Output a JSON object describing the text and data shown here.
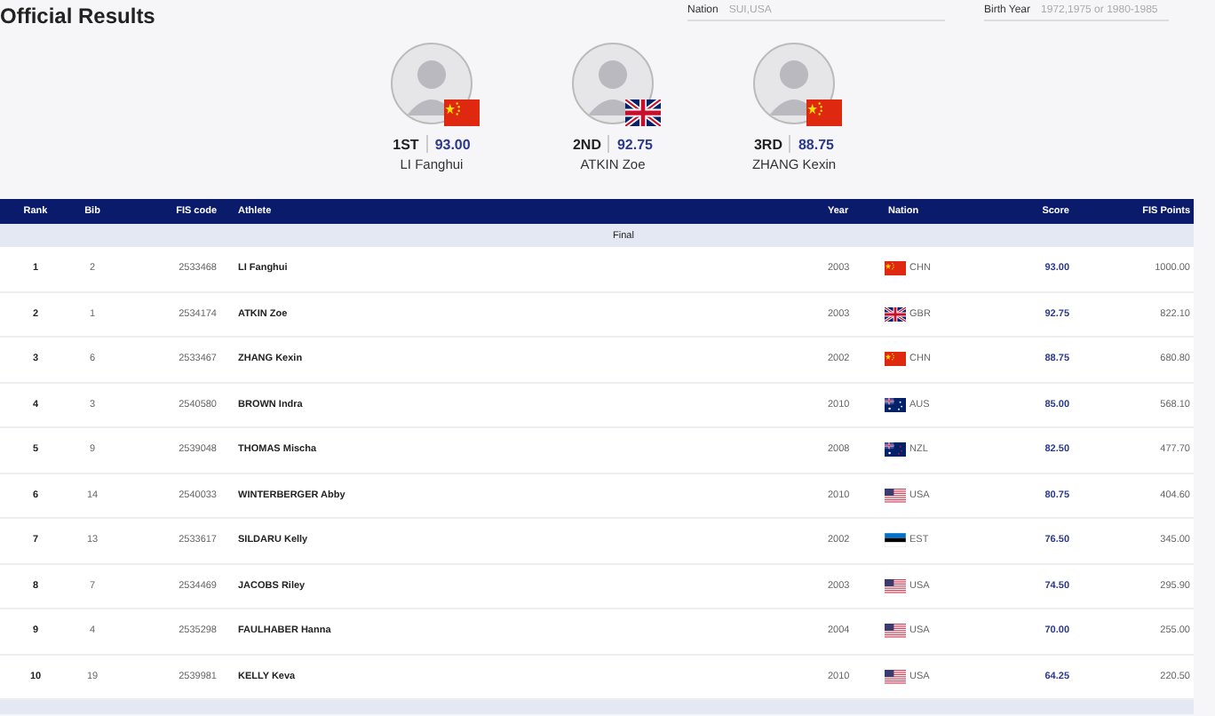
{
  "title": "Official Results",
  "filters": [
    {
      "label": "Nation",
      "placeholder": "SUI,USA"
    },
    {
      "label": "Birth Year",
      "placeholder": "1972,1975 or 1980-1985"
    }
  ],
  "podium": [
    {
      "place": "1ST",
      "score": "93.00",
      "name": "LI Fanghui",
      "kind": "china"
    },
    {
      "place": "2ND",
      "score": "92.75",
      "name": "ATKIN Zoe",
      "kind": "uk"
    },
    {
      "place": "3RD",
      "score": "88.75",
      "name": "ZHANG Kexin",
      "kind": "china"
    }
  ],
  "table": {
    "columns": [
      "Rank",
      "Bib",
      "FIS code",
      "Athlete",
      "Year",
      "Nation",
      "Score",
      "FIS Points"
    ],
    "section": "Final",
    "rows": [
      {
        "rank": "1",
        "bib": "2",
        "fis_code": "2533468",
        "athlete": "LI Fanghui",
        "year": "2003",
        "kind": "china",
        "nation": "CHN",
        "score": "93.00",
        "fis_points": "1000.00"
      },
      {
        "rank": "2",
        "bib": "1",
        "fis_code": "2534174",
        "athlete": "ATKIN Zoe",
        "year": "2003",
        "kind": "uk",
        "nation": "GBR",
        "score": "92.75",
        "fis_points": "822.10"
      },
      {
        "rank": "3",
        "bib": "6",
        "fis_code": "2533467",
        "athlete": "ZHANG Kexin",
        "year": "2002",
        "kind": "china",
        "nation": "CHN",
        "score": "88.75",
        "fis_points": "680.80"
      },
      {
        "rank": "4",
        "bib": "3",
        "fis_code": "2540580",
        "athlete": "BROWN Indra",
        "year": "2010",
        "kind": "australia",
        "nation": "AUS",
        "score": "85.00",
        "fis_points": "568.10"
      },
      {
        "rank": "5",
        "bib": "9",
        "fis_code": "2539048",
        "athlete": "THOMAS Mischa",
        "year": "2008",
        "kind": "newzealand",
        "nation": "NZL",
        "score": "82.50",
        "fis_points": "477.70"
      },
      {
        "rank": "6",
        "bib": "14",
        "fis_code": "2540033",
        "athlete": "WINTERBERGER Abby",
        "year": "2010",
        "kind": "usa",
        "nation": "USA",
        "score": "80.75",
        "fis_points": "404.60"
      },
      {
        "rank": "7",
        "bib": "13",
        "fis_code": "2533617",
        "athlete": "SILDARU Kelly",
        "year": "2002",
        "kind": "estonia",
        "nation": "EST",
        "score": "76.50",
        "fis_points": "345.00"
      },
      {
        "rank": "8",
        "bib": "7",
        "fis_code": "2534469",
        "athlete": "JACOBS Riley",
        "year": "2003",
        "kind": "usa",
        "nation": "USA",
        "score": "74.50",
        "fis_points": "295.90"
      },
      {
        "rank": "9",
        "bib": "4",
        "fis_code": "2535298",
        "athlete": "FAULHABER Hanna",
        "year": "2004",
        "kind": "usa",
        "nation": "USA",
        "score": "70.00",
        "fis_points": "255.00"
      },
      {
        "rank": "10",
        "bib": "19",
        "fis_code": "2539981",
        "athlete": "KELLY Keva",
        "year": "2010",
        "kind": "usa",
        "nation": "USA",
        "score": "64.25",
        "fis_points": "220.50"
      }
    ]
  }
}
